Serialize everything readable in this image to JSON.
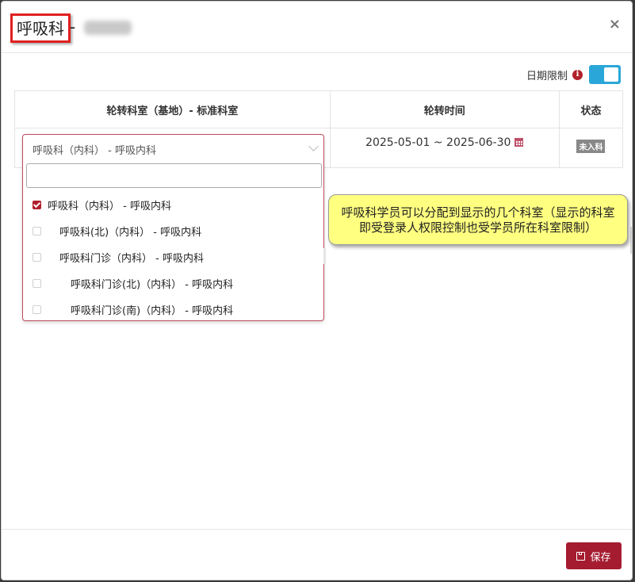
{
  "header": {
    "title": "呼吸科",
    "separator": "-",
    "subtitle_blurred": "",
    "close_label": "×"
  },
  "date_limit": {
    "label": "日期限制",
    "info_icon": "info-circle-icon",
    "toggle_on": true,
    "toggle_color": "#2aa7d8"
  },
  "table": {
    "columns": [
      "轮转科室（基地）- 标准科室",
      "轮转时间",
      "状态"
    ],
    "row": {
      "dept": "呼吸科（内科） - 呼吸内科",
      "time_range": "2025-05-01 ~ 2025-06-30",
      "status": "未入科"
    }
  },
  "dropdown": {
    "search_value": "",
    "search_placeholder": "",
    "options": [
      {
        "label": "呼吸科（内科） - 呼吸内科",
        "checked": true,
        "indent": 0
      },
      {
        "label": "呼吸科(北)（内科） - 呼吸内科",
        "checked": false,
        "indent": 1
      },
      {
        "label": "呼吸科门诊（内科） - 呼吸内科",
        "checked": false,
        "indent": 1
      },
      {
        "label": "呼吸科门诊(北)（内科） - 呼吸内科",
        "checked": false,
        "indent": 2
      },
      {
        "label": "呼吸科门诊(南)（内科） - 呼吸内科",
        "checked": false,
        "indent": 2
      }
    ]
  },
  "callout": {
    "text": "呼吸科学员可以分配到显示的几个科室（显示的科室即受登录人权限控制也受学员所在科室限制）",
    "bg_color": "#ffff80"
  },
  "footer": {
    "save_label": "保存",
    "save_icon": "save-icon",
    "save_color": "#a51c30"
  },
  "colors": {
    "accent": "#b0202a",
    "title_highlight": "#e02020"
  }
}
